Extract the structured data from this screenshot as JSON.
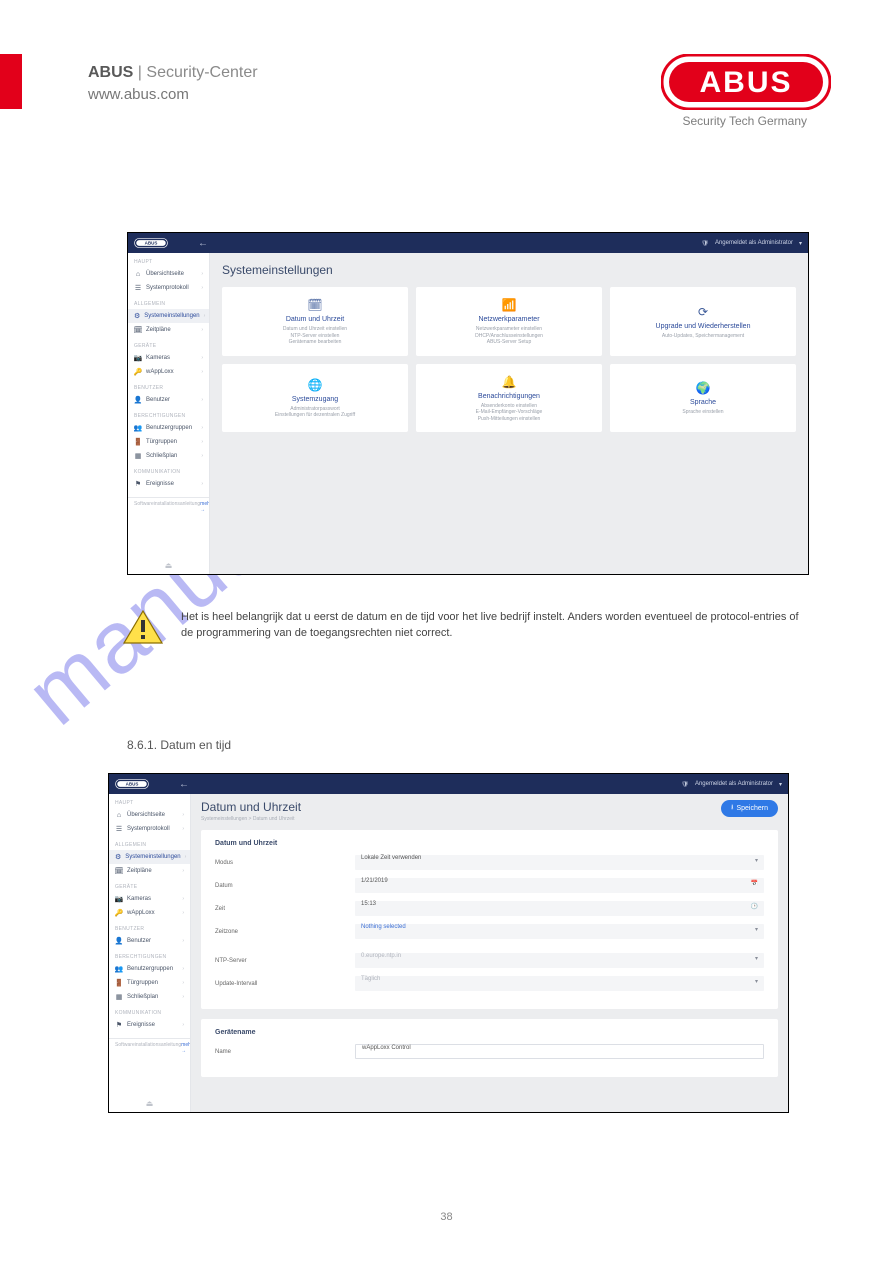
{
  "page": {
    "brand": "ABUS",
    "division": " | Security-Center",
    "url": "www.abus.com",
    "tagline": "Security Tech Germany",
    "watermark": "manualshive.com",
    "page_number": "38"
  },
  "warning": {
    "text": "Het is heel belangrijk dat u eerst de datum en de tijd voor het live bedrijf instelt. Anders worden eventueel de protocol-entries of de programmering van de toegangsrechten niet correct."
  },
  "section_heading": "8.6.1. Datum en tijd",
  "user_status": "Angemeldet als Administrator",
  "sidebar": {
    "groups": [
      {
        "id": "g_haupt",
        "label": "HAUPT",
        "items": [
          {
            "id": "overview",
            "icon": "home-icon",
            "label": "Übersichtseite"
          },
          {
            "id": "protocol",
            "icon": "list-icon",
            "label": "Systemprotokoll"
          }
        ]
      },
      {
        "id": "g_allg",
        "label": "ALLGEMEIN",
        "items": [
          {
            "id": "syssettings",
            "icon": "gear-icon",
            "label": "Systemeinstellungen",
            "active": true
          },
          {
            "id": "timeplan",
            "icon": "calendar-icon",
            "label": "Zeitpläne"
          }
        ]
      },
      {
        "id": "g_dev",
        "label": "GERÄTE",
        "items": [
          {
            "id": "cameras",
            "icon": "camera-icon",
            "label": "Kameras"
          },
          {
            "id": "wapploxx",
            "icon": "key-icon",
            "label": "wAppLoxx"
          }
        ]
      },
      {
        "id": "g_users",
        "label": "BENUTZER",
        "items": [
          {
            "id": "users",
            "icon": "user-icon",
            "label": "Benutzer"
          }
        ]
      },
      {
        "id": "g_perm",
        "label": "BERECHTIGUNGEN",
        "items": [
          {
            "id": "usergroups",
            "icon": "users-icon",
            "label": "Benutzergruppen"
          },
          {
            "id": "doorgroups",
            "icon": "door-icon",
            "label": "Türgruppen"
          },
          {
            "id": "lockplan",
            "icon": "grid-icon",
            "label": "Schließplan"
          }
        ]
      },
      {
        "id": "g_comm",
        "label": "KOMMUNIKATION",
        "items": [
          {
            "id": "events",
            "icon": "flag-icon",
            "label": "Ereignisse"
          }
        ]
      }
    ],
    "footer_left": "Softwareinstallationsanleitung",
    "footer_right": "mehr →"
  },
  "app1": {
    "title": "Systemeinstellungen",
    "cards": [
      {
        "id": "c_date",
        "icon": "calendar-icon",
        "title": "Datum und Uhrzeit",
        "desc": "Datum und Uhrzeit einstellen\nNTP-Server einstellen\nGerätename bearbeiten"
      },
      {
        "id": "c_net",
        "icon": "wifi-icon",
        "title": "Netzwerkparameter",
        "desc": "Netzwerkparameter einstellen\nDHCP/Anschlusseinstellungen\nABUS-Server Setup"
      },
      {
        "id": "c_upg",
        "icon": "refresh-icon",
        "title": "Upgrade und Wiederherstellen",
        "desc": "Auto-Updates, Speichermanagement"
      },
      {
        "id": "c_access",
        "icon": "globe-icon",
        "title": "Systemzugang",
        "desc": "Administratorpasswort\nEinstellungen für dezentralen Zugriff"
      },
      {
        "id": "c_notif",
        "icon": "bell-icon",
        "title": "Benachrichtigungen",
        "desc": "Absenderkonto einstellen\nE-Mail-Empfänger-Vorschläge\nPush-Mitteilungen einstellen"
      },
      {
        "id": "c_lang",
        "icon": "lang-icon",
        "title": "Sprache",
        "desc": "Sprache einstellen"
      }
    ]
  },
  "app2": {
    "title": "Datum und Uhrzeit",
    "breadcrumb": "Systemeinstellungen > Datum und Uhrzeit",
    "save_label": "Speichern",
    "panel1": {
      "title": "Datum und Uhrzeit",
      "fields": {
        "mode_label": "Modus",
        "mode_value": "Lokale Zeit verwenden",
        "date_label": "Datum",
        "date_value": "1/21/2019",
        "time_label": "Zeit",
        "time_value": "15:13",
        "tz_label": "Zeitzone",
        "tz_value": "Nothing selected",
        "ntp_label": "NTP-Server",
        "ntp_value": "0.europe.ntp.in",
        "upd_label": "Update-Intervall",
        "upd_value": "Täglich"
      }
    },
    "panel2": {
      "title": "Gerätename",
      "name_label": "Name",
      "name_value": "wAppLoxx Control"
    }
  },
  "icon_glyph": {
    "home-icon": "⌂",
    "list-icon": "☰",
    "gear-icon": "⚙",
    "calendar-icon": "🗓",
    "camera-icon": "📷",
    "key-icon": "🔑",
    "user-icon": "👤",
    "users-icon": "👥",
    "door-icon": "🚪",
    "grid-icon": "▦",
    "flag-icon": "⚑",
    "wifi-icon": "📶",
    "refresh-icon": "⟳",
    "globe-icon": "🌐",
    "bell-icon": "🔔",
    "lang-icon": "🌍",
    "shield-icon": "🛡",
    "save-icon": "💾"
  }
}
